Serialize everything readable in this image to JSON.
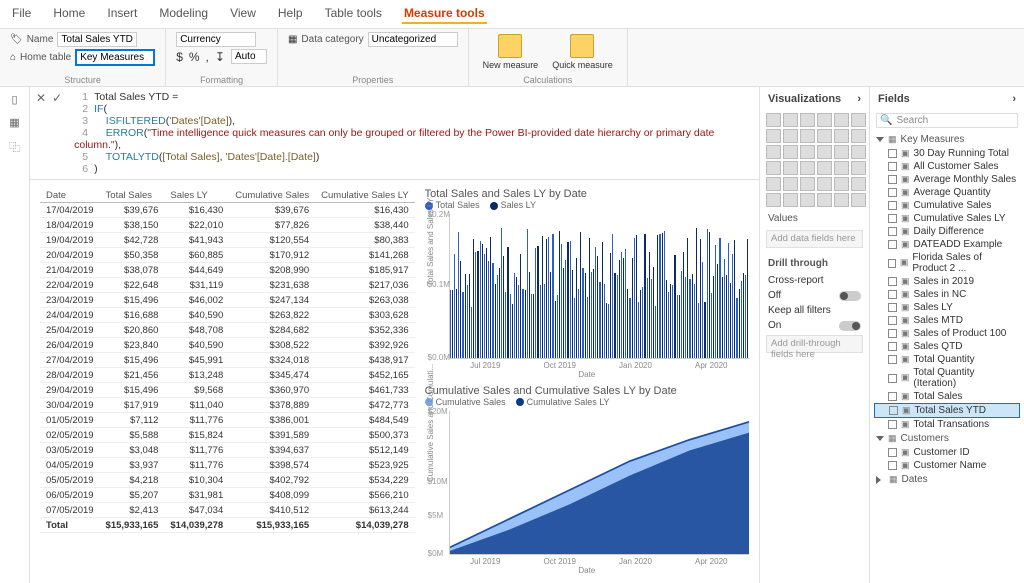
{
  "ribbon": {
    "tabs": [
      "File",
      "Home",
      "Insert",
      "Modeling",
      "View",
      "Help",
      "Table tools",
      "Measure tools"
    ],
    "active": "Measure tools",
    "structure": {
      "name_label": "Name",
      "name_value": "Total Sales YTD",
      "home_table_label": "Home table",
      "home_table_value": "Key Measures",
      "group": "Structure"
    },
    "formatting": {
      "format_value": "Currency",
      "auto_value": "Auto",
      "symbols": [
        "$",
        "%",
        "•",
        ",",
        "↧"
      ],
      "group": "Formatting"
    },
    "properties": {
      "data_category_label": "Data category",
      "data_category_value": "Uncategorized",
      "group": "Properties"
    },
    "calculations": {
      "new_measure": "New measure",
      "quick_measure": "Quick measure",
      "group": "Calculations"
    }
  },
  "formula": {
    "l1": "Total Sales YTD =",
    "l2_kw": "IF",
    "l3_fn": "ISFILTERED",
    "l3_arg": "'Dates'[Date]",
    "l4_fn": "ERROR",
    "l4_str": "\"Time intelligence quick measures can only be grouped or filtered by the Power BI-provided date hierarchy or primary date column.\"",
    "l5_fn": "TOTALYTD",
    "l5_a": "[Total Sales]",
    "l5_b": "'Dates'[Date].[Date]"
  },
  "chart_data": [
    {
      "type": "table",
      "columns": [
        "Date",
        "Total Sales",
        "Sales LY",
        "Cumulative Sales",
        "Cumulative Sales LY"
      ],
      "rows": [
        [
          "17/04/2019",
          "$39,676",
          "$16,430",
          "$39,676",
          "$16,430"
        ],
        [
          "18/04/2019",
          "$38,150",
          "$22,010",
          "$77,826",
          "$38,440"
        ],
        [
          "19/04/2019",
          "$42,728",
          "$41,943",
          "$120,554",
          "$80,383"
        ],
        [
          "20/04/2019",
          "$50,358",
          "$60,885",
          "$170,912",
          "$141,268"
        ],
        [
          "21/04/2019",
          "$38,078",
          "$44,649",
          "$208,990",
          "$185,917"
        ],
        [
          "22/04/2019",
          "$22,648",
          "$31,119",
          "$231,638",
          "$217,036"
        ],
        [
          "23/04/2019",
          "$15,496",
          "$46,002",
          "$247,134",
          "$263,038"
        ],
        [
          "24/04/2019",
          "$16,688",
          "$40,590",
          "$263,822",
          "$303,628"
        ],
        [
          "25/04/2019",
          "$20,860",
          "$48,708",
          "$284,682",
          "$352,336"
        ],
        [
          "26/04/2019",
          "$23,840",
          "$40,590",
          "$308,522",
          "$392,926"
        ],
        [
          "27/04/2019",
          "$15,496",
          "$45,991",
          "$324,018",
          "$438,917"
        ],
        [
          "28/04/2019",
          "$21,456",
          "$13,248",
          "$345,474",
          "$452,165"
        ],
        [
          "29/04/2019",
          "$15,496",
          "$9,568",
          "$360,970",
          "$461,733"
        ],
        [
          "30/04/2019",
          "$17,919",
          "$11,040",
          "$378,889",
          "$472,773"
        ],
        [
          "01/05/2019",
          "$7,112",
          "$11,776",
          "$386,001",
          "$484,549"
        ],
        [
          "02/05/2019",
          "$5,588",
          "$15,824",
          "$391,589",
          "$500,373"
        ],
        [
          "03/05/2019",
          "$3,048",
          "$11,776",
          "$394,637",
          "$512,149"
        ],
        [
          "04/05/2019",
          "$3,937",
          "$11,776",
          "$398,574",
          "$523,925"
        ],
        [
          "05/05/2019",
          "$4,218",
          "$10,304",
          "$402,792",
          "$534,229"
        ],
        [
          "06/05/2019",
          "$5,207",
          "$31,981",
          "$408,099",
          "$566,210"
        ],
        [
          "07/05/2019",
          "$2,413",
          "$47,034",
          "$410,512",
          "$613,244"
        ]
      ],
      "total": [
        "Total",
        "$15,933,165",
        "$14,039,278",
        "$15,933,165",
        "$14,039,278"
      ]
    },
    {
      "type": "bar",
      "title": "Total Sales and Sales LY by Date",
      "series": [
        {
          "name": "Total Sales",
          "color": "#2a5fcd"
        },
        {
          "name": "Sales LY",
          "color": "#0b2a66"
        }
      ],
      "xlabel": "Date",
      "ylabel": "Total Sales and Sales LY",
      "yticks": [
        "$0.2M",
        "$0.1M",
        "$0.0M"
      ],
      "xticks": [
        "Jul 2019",
        "Oct 2019",
        "Jan 2020",
        "Apr 2020"
      ],
      "ylim": [
        0,
        0.2
      ]
    },
    {
      "type": "area",
      "title": "Cumulative Sales and Cumulative Sales LY by Date",
      "series": [
        {
          "name": "Cumulative Sales",
          "color": "#6fa8f5"
        },
        {
          "name": "Cumulative Sales LY",
          "color": "#0b3b8c"
        }
      ],
      "xlabel": "Date",
      "ylabel": "Cumulative Sales and Cumulati...",
      "yticks": [
        "$20M",
        "$10M",
        "$5M",
        "$0M"
      ],
      "xticks": [
        "Jul 2019",
        "Oct 2019",
        "Jan 2020",
        "Apr 2020"
      ],
      "ylim": [
        0,
        20
      ]
    }
  ],
  "viz_pane": {
    "title": "Visualizations",
    "values": "Values",
    "values_well": "Add data fields here",
    "drill": "Drill through",
    "cross": "Cross-report",
    "off": "Off",
    "keep": "Keep all filters",
    "on": "On",
    "drill_well": "Add drill-through fields here"
  },
  "fields_pane": {
    "title": "Fields",
    "search": "Search",
    "groups": [
      {
        "name": "Key Measures",
        "fields": [
          "30 Day Running Total",
          "All Customer Sales",
          "Average Monthly Sales",
          "Average Quantity",
          "Cumulative Sales",
          "Cumulative Sales LY",
          "Daily Difference",
          "DATEADD Example",
          "Florida Sales of Product 2 ...",
          "Sales in 2019",
          "Sales in NC",
          "Sales LY",
          "Sales MTD",
          "Sales of Product 100",
          "Sales QTD",
          "Total Quantity",
          "Total Quantity (Iteration)",
          "Total Sales",
          "Total Sales YTD",
          "Total Transations"
        ],
        "selected": "Total Sales YTD"
      },
      {
        "name": "Customers",
        "fields": [
          "Customer ID",
          "Customer Name"
        ]
      },
      {
        "name": "Dates",
        "fields": []
      }
    ]
  }
}
